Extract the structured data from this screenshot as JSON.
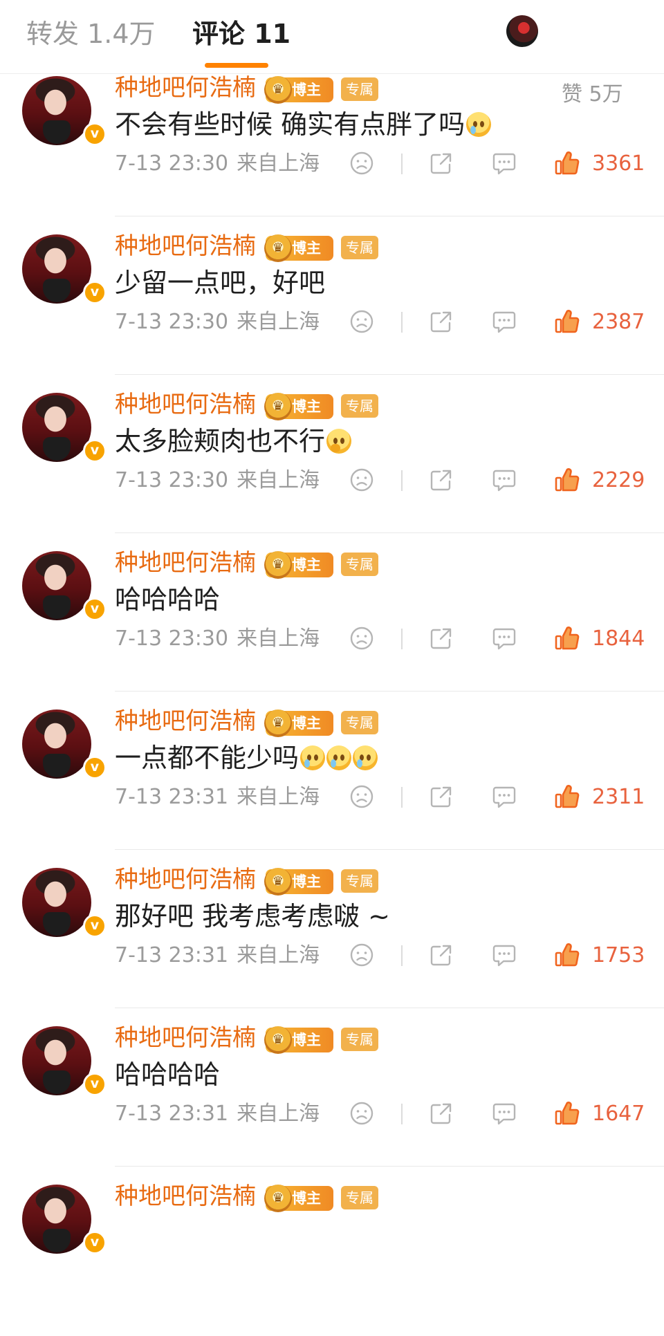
{
  "header": {
    "reposts_tab": "转发 1.4万",
    "comments_tab": "评论 11",
    "likes_tab": "赞 5万"
  },
  "badges": {
    "host": "博主",
    "exclusive": "专属"
  },
  "colors": {
    "accent": "#ff8200",
    "name": "#e86b12",
    "like": "#e8623e"
  },
  "comments": [
    {
      "user": "种地吧何浩楠",
      "text": "不会有些时候 确实有点胖了吗",
      "emoji": [
        "crying-face"
      ],
      "time": "7-13 23:30",
      "location": "来自上海",
      "likes": "3361"
    },
    {
      "user": "种地吧何浩楠",
      "text": "少留一点吧，好吧",
      "emoji": [],
      "time": "7-13 23:30",
      "location": "来自上海",
      "likes": "2387"
    },
    {
      "user": "种地吧何浩楠",
      "text": "太多脸颊肉也不行",
      "emoji": [
        "thinking-face"
      ],
      "time": "7-13 23:30",
      "location": "来自上海",
      "likes": "2229"
    },
    {
      "user": "种地吧何浩楠",
      "text": "哈哈哈哈",
      "emoji": [],
      "time": "7-13 23:30",
      "location": "来自上海",
      "likes": "1844"
    },
    {
      "user": "种地吧何浩楠",
      "text": "一点都不能少吗",
      "emoji": [
        "crying-face",
        "crying-face",
        "crying-face"
      ],
      "time": "7-13 23:31",
      "location": "来自上海",
      "likes": "2311"
    },
    {
      "user": "种地吧何浩楠",
      "text": "那好吧 我考虑考虑啵 ~",
      "emoji": [],
      "time": "7-13 23:31",
      "location": "来自上海",
      "likes": "1753"
    },
    {
      "user": "种地吧何浩楠",
      "text": "哈哈哈哈",
      "emoji": [],
      "time": "7-13 23:31",
      "location": "来自上海",
      "likes": "1647"
    },
    {
      "user": "种地吧何浩楠",
      "text": "",
      "emoji": [],
      "time": "",
      "location": "",
      "likes": ""
    }
  ]
}
